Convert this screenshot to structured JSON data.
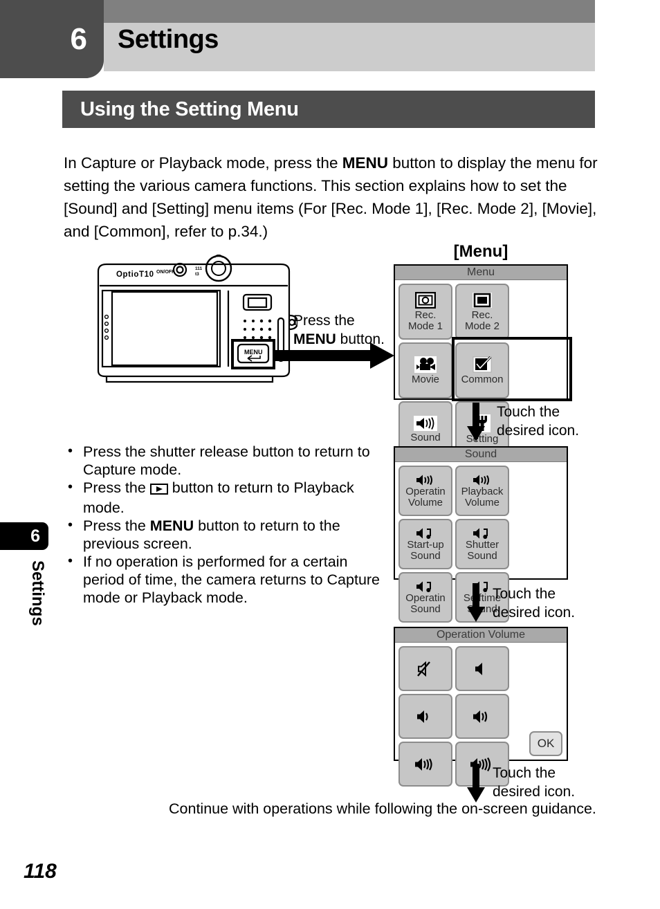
{
  "chapter": {
    "number": "6",
    "title": "Settings"
  },
  "section": {
    "title": "Using the Setting Menu"
  },
  "intro": {
    "part1": "In Capture or Playback mode, press the ",
    "menu_bold": "MENU",
    "part2": " button to display the menu for setting the various camera functions. This section explains how to set the [Sound] and [Setting] menu items (For [Rec. Mode 1], [Rec. Mode 2], [Movie], and [Common], refer to p.34.)"
  },
  "side_tab": {
    "number": "6",
    "label": "Settings"
  },
  "page_number": "118",
  "camera": {
    "model_text": "OptioT10",
    "onoff_text": "ON/OFF",
    "menu_button_text": "MENU"
  },
  "press_caption": {
    "line1": "Press the",
    "bold": "MENU",
    "line2": " button."
  },
  "menu_heading": "[Menu]",
  "screens": {
    "menu": {
      "title": "Menu",
      "cells": [
        {
          "icon": "camera-rec-icon",
          "label": "Rec.\nMode 1"
        },
        {
          "icon": "screen-rec-icon",
          "label": "Rec.\nMode 2"
        },
        {
          "icon": "movie-camera-icon",
          "label": "Movie"
        },
        {
          "icon": "checkmark-icon",
          "label": "Common"
        },
        {
          "icon": "speaker-sound-icon",
          "label": "Sound"
        },
        {
          "icon": "wrench-icon",
          "label": "Setting"
        }
      ]
    },
    "sound": {
      "title": "Sound",
      "cells": [
        {
          "icon": "speaker-volume-icon",
          "label": "Operatin\nVolume"
        },
        {
          "icon": "speaker-volume-icon",
          "label": "Playback\nVolume"
        },
        {
          "icon": "speaker-note-icon",
          "label": "Start-up\nSound"
        },
        {
          "icon": "speaker-note-icon",
          "label": "Shutter\nSound"
        },
        {
          "icon": "speaker-note-icon",
          "label": "Operatin\nSound"
        },
        {
          "icon": "speaker-note-icon",
          "label": "Selftime\nSound"
        }
      ]
    },
    "volume": {
      "title": "Operation Volume",
      "cells": [
        {
          "icon": "speaker-mute-icon",
          "label": ""
        },
        {
          "icon": "speaker-level1-icon",
          "label": ""
        },
        {
          "icon": "speaker-level2-icon",
          "label": ""
        },
        {
          "icon": "speaker-level3-icon",
          "label": ""
        },
        {
          "icon": "speaker-level4-icon",
          "label": ""
        },
        {
          "icon": "speaker-level5-icon",
          "label": ""
        }
      ],
      "ok_label": "OK"
    }
  },
  "steps": {
    "touch1": "Touch the\ndesired icon.",
    "touch2": "Touch the\ndesired icon.",
    "touch3": "Touch the\ndesired icon."
  },
  "bullets": [
    {
      "pre": "Press the shutter release button to return to Capture mode.",
      "icon": null,
      "post": ""
    },
    {
      "pre": "Press the ",
      "icon": "playback-button-icon",
      "post": " button to return to Playback mode."
    },
    {
      "pre": "Press the ",
      "bold": "MENU",
      "post": " button to return to the previous screen."
    },
    {
      "pre": "If no operation is performed for a certain period of time, the camera returns to Capture mode or Playback mode.",
      "icon": null,
      "post": ""
    }
  ],
  "closing_text": "Continue with operations while following the on-screen guidance.",
  "colors": {
    "header_dark": "#4d4d4d",
    "header_band": "#808080",
    "header_light": "#cccccc",
    "screen_title_bg": "#a9a9a9",
    "cell_bg": "#c6c6c6",
    "cell_border": "#8c8c8c"
  }
}
